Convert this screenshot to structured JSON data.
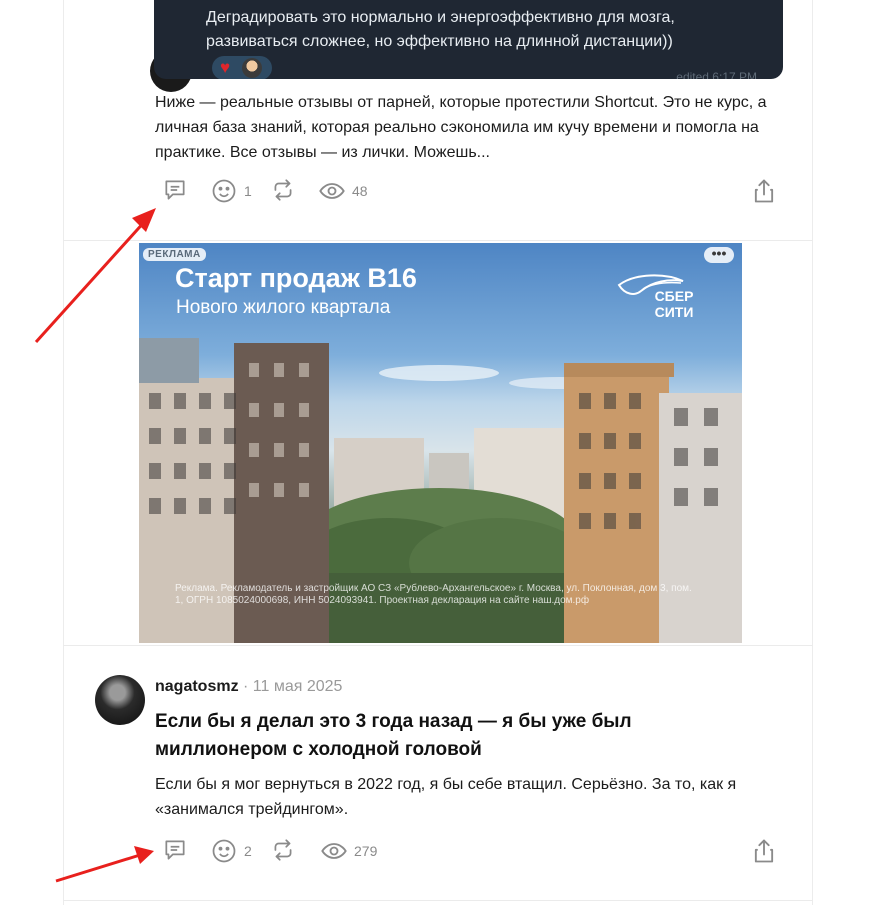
{
  "chat": {
    "message": "Деградировать это нормально и энергоэффективно для мозга, развиваться сложнее, но эффективно на длинной дистанции))",
    "time": "edited 6:17 PM"
  },
  "post1": {
    "excerpt": "Ниже — реальные отзывы от парней, которые протестили Shortcut. Это не курс, а личная база знаний, которая реально сэкономила им кучу времени и помогла на практике. Все отзывы — из лички. Можешь...",
    "reactions": "1",
    "views": "48"
  },
  "ad": {
    "badge": "РЕКЛАМА",
    "dots": "•••",
    "title": "Старт продаж В16",
    "subtitle": "Нового жилого квартала",
    "brand_line1": "СБЕР",
    "brand_line2": "СИТИ",
    "legal": "Реклама. Рекламодатель и застройщик АО СЗ «Рублево-Архангельское» г. Москва, ул. Поклонная, дом 3, пом. 1, ОГРН 1085024000698, ИНН 5024093941. Проектная декларация на сайте наш.дом.рф"
  },
  "post2": {
    "author": "nagatosmz",
    "separator": " · ",
    "date": "11 мая 2025",
    "title": "Если бы я делал это 3 года назад — я бы уже был миллионером с холодной головой",
    "excerpt": "Если бы я мог вернуться в 2022 год, я бы себе втащил. Серьёзно. За то, как я «занимался трейдингом».",
    "reactions": "2",
    "views": "279"
  },
  "colors": {
    "annotation_arrow": "#e8201d",
    "icon_gray": "#8a8a8a",
    "chat_bg": "#1f2733"
  }
}
